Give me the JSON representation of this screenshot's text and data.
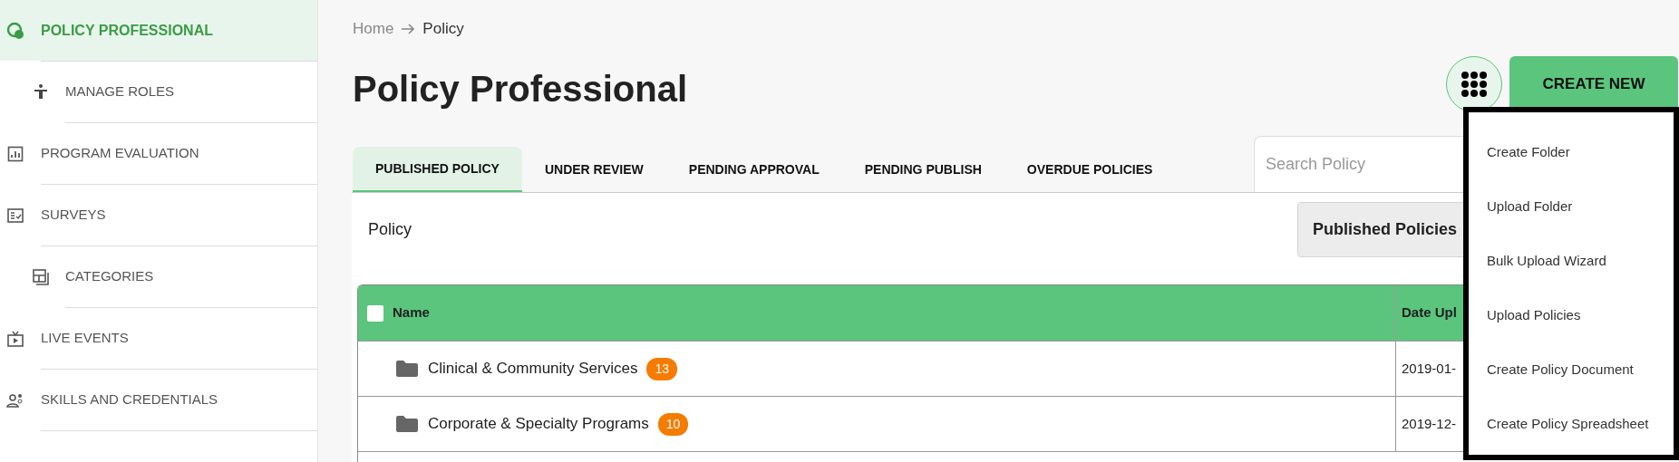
{
  "sidebar": {
    "items": [
      {
        "label": "POLICY PROFESSIONAL",
        "selected": true,
        "children": [
          {
            "label": "MANAGE ROLES",
            "selected": false
          }
        ]
      },
      {
        "label": "PROGRAM EVALUATION",
        "selected": false
      },
      {
        "label": "SURVEYS",
        "selected": false,
        "children": [
          {
            "label": "CATEGORIES",
            "selected": false
          }
        ]
      },
      {
        "label": "LIVE EVENTS",
        "selected": false
      },
      {
        "label": "SKILLS AND CREDENTIALS",
        "selected": false
      }
    ]
  },
  "breadcrumb": [
    "Home",
    "Policy"
  ],
  "page_title": "Policy Professional",
  "create_new": {
    "label": "CREATE NEW",
    "expanded": true
  },
  "tabs": [
    {
      "label": "PUBLISHED POLICY",
      "selected": true
    },
    {
      "label": "UNDER REVIEW",
      "selected": false
    },
    {
      "label": "PENDING APPROVAL",
      "selected": false
    },
    {
      "label": "PENDING PUBLISH",
      "selected": false
    },
    {
      "label": "OVERDUE POLICIES",
      "selected": false
    }
  ],
  "search": {
    "placeholder": "Search Policy"
  },
  "section_label": "Policy",
  "filter": {
    "value": "Published Policies"
  },
  "table": {
    "select_all": {
      "checked": false
    },
    "columns": [
      "Name",
      "Date Upl"
    ],
    "rows": [
      {
        "name": "Clinical & Community Services",
        "count": "13",
        "date": "2019-01-"
      },
      {
        "name": "Corporate & Specialty Programs",
        "count": "10",
        "date": "2019-12-"
      }
    ]
  },
  "create_menu": {
    "items": [
      "Create Folder",
      "Upload Folder",
      "Bulk Upload Wizard",
      "Upload Policies",
      "Create Policy Document",
      "Create Policy Spreadsheet"
    ]
  }
}
